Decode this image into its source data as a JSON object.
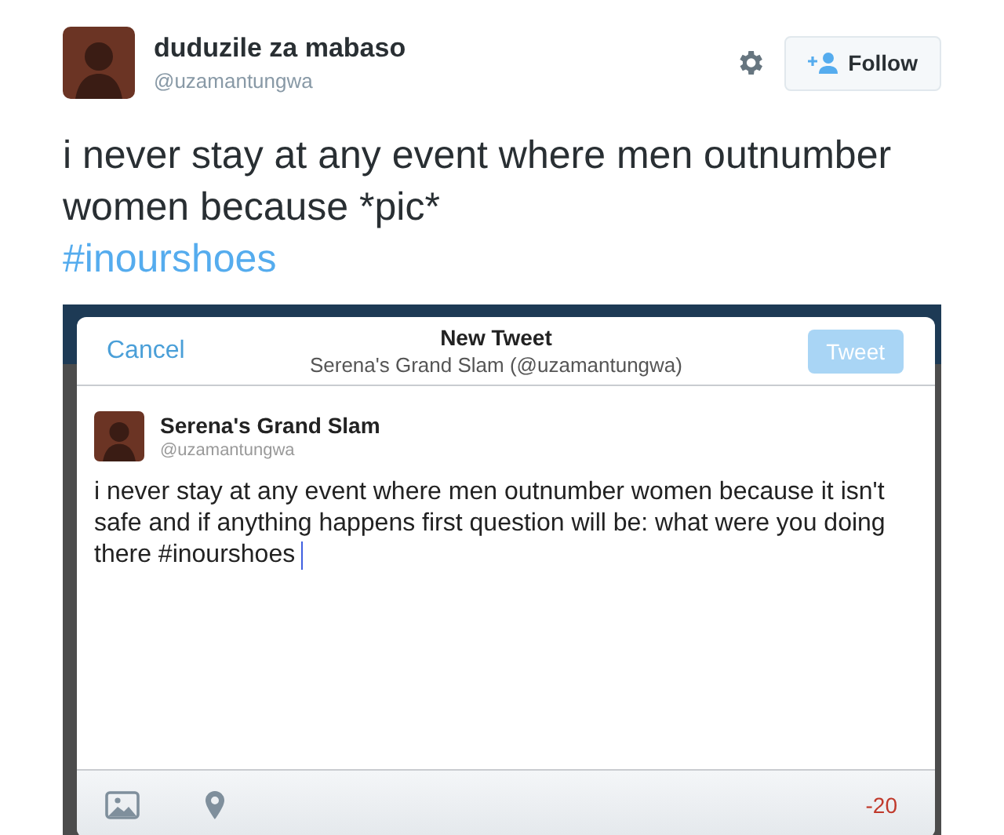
{
  "tweet": {
    "author": "duduzile za mabaso",
    "handle": "@uzamantungwa",
    "follow_button": "Follow",
    "text": "i never stay at any event where men outnumber women because *pic*",
    "hashtag": "#inourshoes"
  },
  "compose": {
    "cancel": "Cancel",
    "title": "New Tweet",
    "subtitle": "Serena's Grand Slam (@uzamantungwa)",
    "tweet_button": "Tweet",
    "tweet_disabled": true,
    "account_name": "Serena's Grand Slam",
    "account_handle": "@uzamantungwa",
    "body": "i never stay at any event where men outnumber women because it isn't safe and if anything happens first question will be: what were you doing there #inourshoes",
    "counter": "-20",
    "over_limit": true
  }
}
